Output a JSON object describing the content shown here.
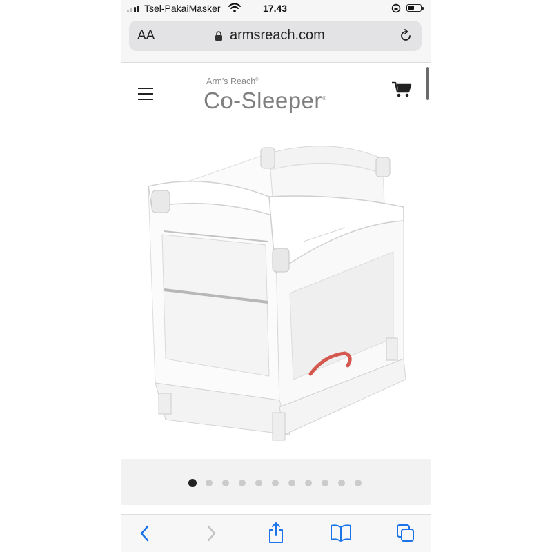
{
  "status_bar": {
    "carrier": "Tsel-PakaiMasker",
    "time": "17.43",
    "icons": [
      "signal-icon",
      "wifi-icon",
      "rotation-lock-icon",
      "battery-icon"
    ]
  },
  "browser": {
    "text_size_button": "AA",
    "url": "armsreach.com",
    "icons": [
      "lock-icon",
      "reload-icon"
    ]
  },
  "site": {
    "logo_small": "Arm's Reach",
    "logo_big": "Co-Sleeper",
    "icons": [
      "hamburger-menu-icon",
      "shopping-cart-icon"
    ],
    "colors": {
      "moon": "#ecd989",
      "logo_text": "#7f7f7f",
      "strap": "#d4584e"
    }
  },
  "carousel": {
    "dot_count": 11,
    "active_index": 0
  },
  "toolbar": {
    "icons": [
      "back-icon",
      "forward-icon",
      "share-icon",
      "bookmarks-icon",
      "tabs-icon"
    ],
    "accent": "#1a73e8"
  }
}
